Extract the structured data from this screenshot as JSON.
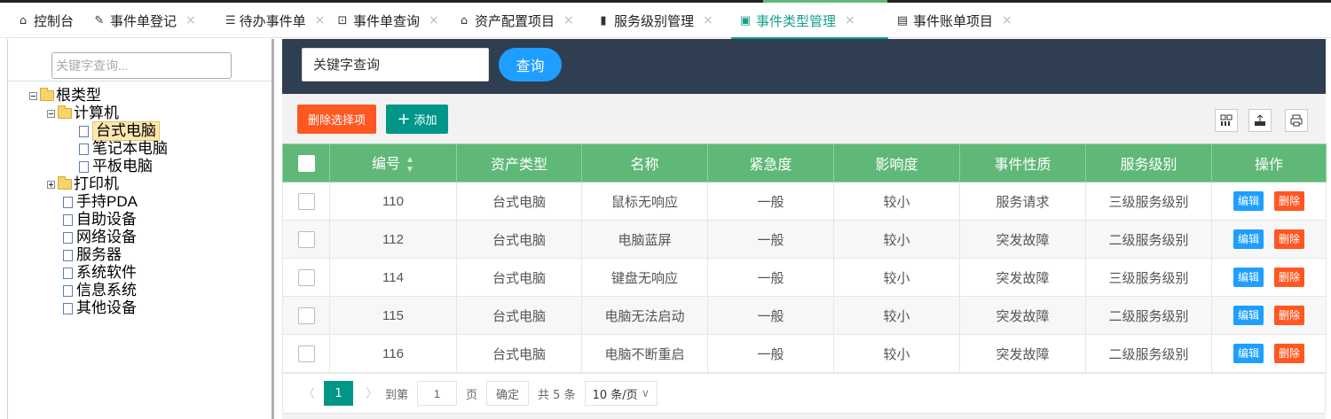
{
  "tabs": [
    {
      "label": "控制台",
      "icon": "home-icon",
      "closable": false
    },
    {
      "label": "事件单登记",
      "icon": "edit-doc-icon",
      "closable": true
    },
    {
      "label": "待办事件单",
      "icon": "list-doc-icon",
      "closable": true
    },
    {
      "label": "事件单查询",
      "icon": "search-doc-icon",
      "closable": true
    },
    {
      "label": "资产配置项目",
      "icon": "house-icon",
      "closable": true
    },
    {
      "label": "服务级别管理",
      "icon": "bars-icon",
      "closable": true
    },
    {
      "label": "事件类型管理",
      "icon": "type-doc-icon",
      "closable": true,
      "active": true
    },
    {
      "label": "事件账单项目",
      "icon": "bill-icon",
      "closable": true
    }
  ],
  "tree": {
    "search_placeholder": "关键字查询...",
    "nodes": [
      {
        "label": "根类型",
        "kind": "folder",
        "toggle": "minus"
      },
      {
        "label": "计算机",
        "kind": "folder",
        "toggle": "minus"
      },
      {
        "label": "台式电脑",
        "kind": "doc",
        "selected": true
      },
      {
        "label": "笔记本电脑",
        "kind": "doc"
      },
      {
        "label": "平板电脑",
        "kind": "doc"
      },
      {
        "label": "打印机",
        "kind": "folder",
        "toggle": "plus"
      },
      {
        "label": "手持PDA",
        "kind": "doc"
      },
      {
        "label": "自助设备",
        "kind": "doc"
      },
      {
        "label": "网络设备",
        "kind": "doc"
      },
      {
        "label": "服务器",
        "kind": "doc"
      },
      {
        "label": "系统软件",
        "kind": "doc"
      },
      {
        "label": "信息系统",
        "kind": "doc"
      },
      {
        "label": "其他设备",
        "kind": "doc"
      }
    ]
  },
  "search": {
    "placeholder": "关键字查询",
    "button": "查询"
  },
  "toolbar": {
    "delete_selected": "删除选择项",
    "add": "添加"
  },
  "table": {
    "headers": [
      "编号",
      "资产类型",
      "名称",
      "紧急度",
      "影响度",
      "事件性质",
      "服务级别",
      "操作"
    ],
    "edit_label": "编辑",
    "delete_label": "删除",
    "rows": [
      [
        "110",
        "台式电脑",
        "鼠标无响应",
        "一般",
        "较小",
        "服务请求",
        "三级服务级别"
      ],
      [
        "112",
        "台式电脑",
        "电脑蓝屏",
        "一般",
        "较小",
        "突发故障",
        "二级服务级别"
      ],
      [
        "114",
        "台式电脑",
        "键盘无响应",
        "一般",
        "较小",
        "突发故障",
        "三级服务级别"
      ],
      [
        "115",
        "台式电脑",
        "电脑无法启动",
        "一般",
        "较小",
        "突发故障",
        "二级服务级别"
      ],
      [
        "116",
        "台式电脑",
        "电脑不断重启",
        "一般",
        "较小",
        "突发故障",
        "二级服务级别"
      ]
    ]
  },
  "pager": {
    "current_page": "1",
    "goto_label": "到第",
    "goto_value": "1",
    "page_unit": "页",
    "confirm": "确定",
    "total": "共 5 条",
    "page_size": "10 条/页"
  },
  "colors": {
    "accent": "#009688",
    "header_green": "#5fb878",
    "blue": "#1e9fff",
    "danger": "#ff5722",
    "topbar": "#2f3e51"
  }
}
